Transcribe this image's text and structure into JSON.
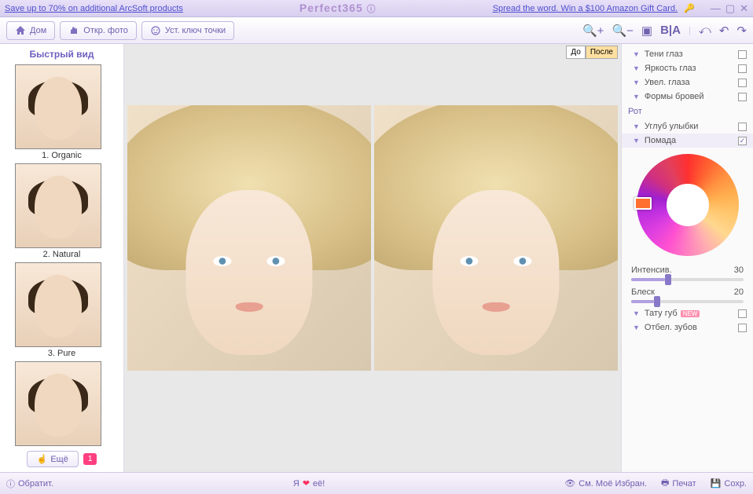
{
  "titlebar": {
    "left_link": "Save up to 70% on additional ArcSoft products",
    "app_name": "Perfect365",
    "right_link": "Spread the word. Win a $100 Amazon Gift Card."
  },
  "toolbar": {
    "home": "Дом",
    "open": "Откр. фото",
    "keypoints": "Уст. ключ точки",
    "compare": "B|A"
  },
  "sidebar": {
    "title": "Быстрый вид",
    "thumbs": [
      {
        "label": "1. Organic"
      },
      {
        "label": "2. Natural"
      },
      {
        "label": "3. Pure"
      }
    ],
    "more": "Ещё",
    "badge": "1"
  },
  "before_after": {
    "before": "До",
    "after": "После"
  },
  "panels": {
    "eye_shadow": "Тени глаз",
    "eye_brightness": "Яркость глаз",
    "eye_enlarge": "Увел. глаза",
    "brow_shapes": "Формы бровей",
    "mouth_group": "Рот",
    "smile_deepen": "Углуб улыбки",
    "lipstick": "Помада",
    "intensity_label": "Интенсив.",
    "intensity_value": "30",
    "gloss_label": "Блеск",
    "gloss_value": "20",
    "lip_tattoo": "Тату губ",
    "teeth_whitening": "Отбел. зубов"
  },
  "statusbar": {
    "feedback": "Обратит.",
    "i_love_pre": "Я",
    "i_love_post": "её!",
    "favorites": "См. Моё Избран.",
    "print": "Печат",
    "save": "Сохр."
  }
}
